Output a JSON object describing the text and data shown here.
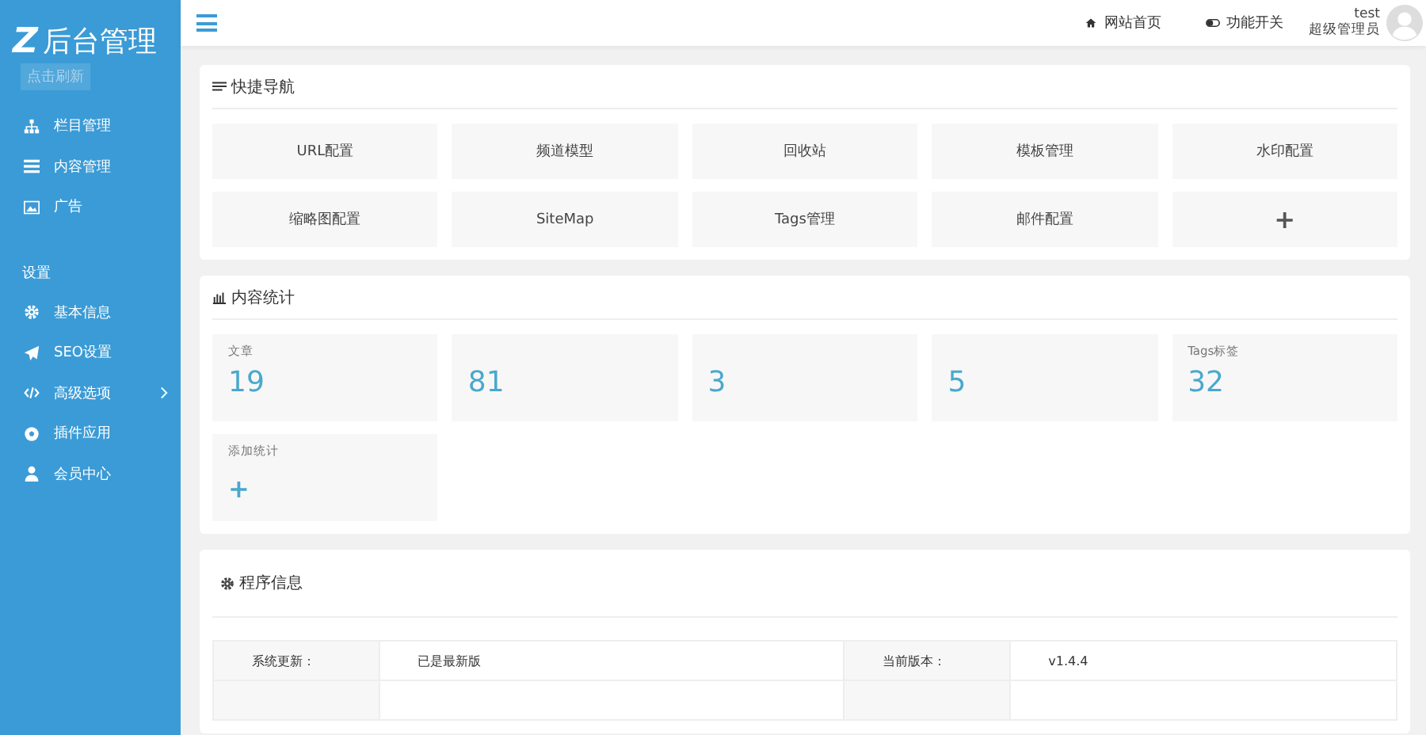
{
  "logo": {
    "mark": "Z",
    "title": "后台管理",
    "refresh": "点击刷新"
  },
  "sidebar": {
    "groups": [
      {
        "items": [
          {
            "label": "栏目管理",
            "kind": "sitemap",
            "has_children": false
          },
          {
            "label": "内容管理",
            "kind": "list",
            "has_children": false
          },
          {
            "label": "广告",
            "kind": "image",
            "has_children": false
          }
        ]
      },
      {
        "label": "设置",
        "items": [
          {
            "label": "基本信息",
            "kind": "gear",
            "has_children": false
          },
          {
            "label": "SEO设置",
            "kind": "plane",
            "has_children": false
          },
          {
            "label": "高级选项",
            "kind": "code",
            "has_children": true
          },
          {
            "label": "插件应用",
            "kind": "ball",
            "has_children": false
          },
          {
            "label": "会员中心",
            "kind": "user",
            "has_children": false
          }
        ]
      }
    ]
  },
  "topbar": {
    "links": [
      {
        "label": "网站首页",
        "kind": "home"
      },
      {
        "label": "功能开关",
        "kind": "toggle"
      }
    ],
    "user": {
      "name": "test",
      "role": "超级管理员"
    }
  },
  "quick_nav": {
    "title": "快捷导航",
    "items": [
      {
        "label": "URL配置",
        "kind": "text"
      },
      {
        "label": "频道模型",
        "kind": "text"
      },
      {
        "label": "回收站",
        "kind": "text"
      },
      {
        "label": "模板管理",
        "kind": "text"
      },
      {
        "label": "水印配置",
        "kind": "text"
      },
      {
        "label": "缩略图配置",
        "kind": "text"
      },
      {
        "label": "SiteMap",
        "kind": "text"
      },
      {
        "label": "Tags管理",
        "kind": "text"
      },
      {
        "label": "邮件配置",
        "kind": "text"
      },
      {
        "label": "+",
        "kind": "add"
      }
    ]
  },
  "stats": {
    "title": "内容统计",
    "items": [
      {
        "label": "文章",
        "value": "19",
        "kind": "stat"
      },
      {
        "value": "81",
        "kind": "stat"
      },
      {
        "value": "3",
        "kind": "stat"
      },
      {
        "value": "5",
        "kind": "stat"
      },
      {
        "label": "Tags标签",
        "value": "32",
        "kind": "stat"
      },
      {
        "label": "添加统计",
        "value": "+",
        "kind": "add"
      }
    ]
  },
  "program_info": {
    "title": "程序信息",
    "rows": [
      [
        "系统更新：",
        "已是最新版",
        "当前版本：",
        "v1.4.4"
      ]
    ]
  }
}
